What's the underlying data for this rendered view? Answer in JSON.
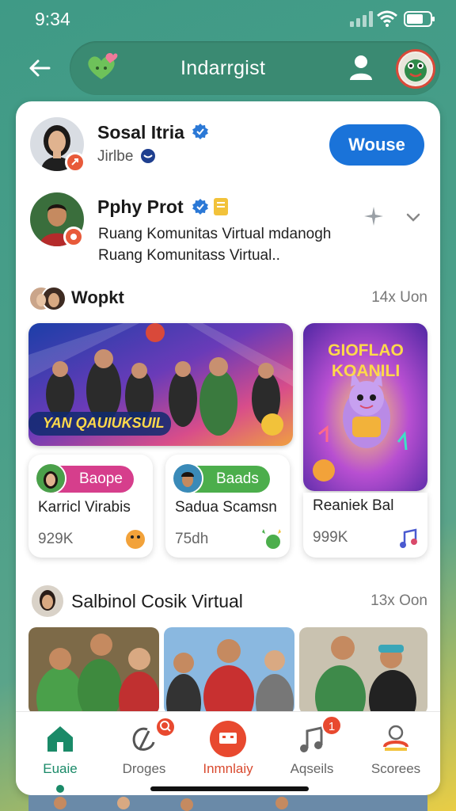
{
  "status_bar": {
    "time": "9:34"
  },
  "header": {
    "title": "Indarrgist",
    "icons": [
      "back-arrow-icon",
      "heart-logo-icon",
      "user-icon",
      "profile-avatar"
    ]
  },
  "colors": {
    "accent": "#1a73d9",
    "brand_green": "#3a8a72",
    "badge_red": "#e8492f",
    "active_green": "#1a8a68"
  },
  "posts": [
    {
      "name": "Sosal Itria",
      "handle": "Jirlbe",
      "button": "Wouse"
    },
    {
      "name": "Pphy Prot",
      "text_line1": "Ruang Komunitas Virtual mdanogh",
      "text_line2": "Ruang Komunitass Virtual.."
    }
  ],
  "section1": {
    "title": "Wopkt",
    "meta": "14x Uon",
    "banner_caption": "YAN QAUIUKSUIL",
    "poster_text": "GIOFLAO KOANILI",
    "cards": [
      {
        "chip": "Baope",
        "chip_color": "#d63e8c",
        "title": "Karricl Virabis",
        "count": "929K"
      },
      {
        "chip": "Baads",
        "chip_color": "#4cae4c",
        "title": "Sadua Scamsn",
        "count": "75dh"
      },
      {
        "title": "Reaniek Bal",
        "count": "999K"
      }
    ]
  },
  "section2": {
    "title": "Salbinol Cosik Virtual",
    "meta": "13x Oon"
  },
  "bottom_nav": {
    "items": [
      {
        "label": "Euaie",
        "active": true
      },
      {
        "label": "Droges",
        "badge": ""
      },
      {
        "label": "Inmnlaiy"
      },
      {
        "label": "Aqseils",
        "badge": "1"
      },
      {
        "label": "Scorees"
      }
    ]
  }
}
